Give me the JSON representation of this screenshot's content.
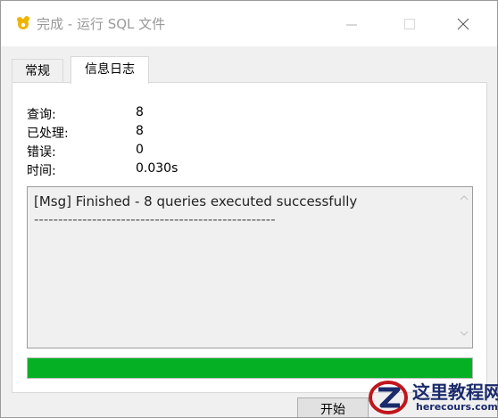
{
  "window": {
    "title": "完成 - 运行 SQL 文件"
  },
  "tabs": [
    {
      "label": "常规",
      "active": false
    },
    {
      "label": "信息日志",
      "active": true
    }
  ],
  "stats": [
    {
      "label": "查询:",
      "value": "8"
    },
    {
      "label": "已处理:",
      "value": "8"
    },
    {
      "label": "错误:",
      "value": "0"
    },
    {
      "label": "时间:",
      "value": "0.030s"
    }
  ],
  "log": {
    "lines": [
      "[Msg] Finished - 8 queries executed successfully",
      "--------------------------------------------------"
    ]
  },
  "progress": {
    "fraction": 1.0,
    "color": "#06b025"
  },
  "buttons": {
    "start_label": "开始"
  },
  "watermark": {
    "title": "这里教程网",
    "url": "herecours.com"
  },
  "icons": {
    "app": "cloud-icon",
    "minimize": "minimize-icon",
    "maximize": "maximize-icon",
    "close": "close-icon"
  }
}
